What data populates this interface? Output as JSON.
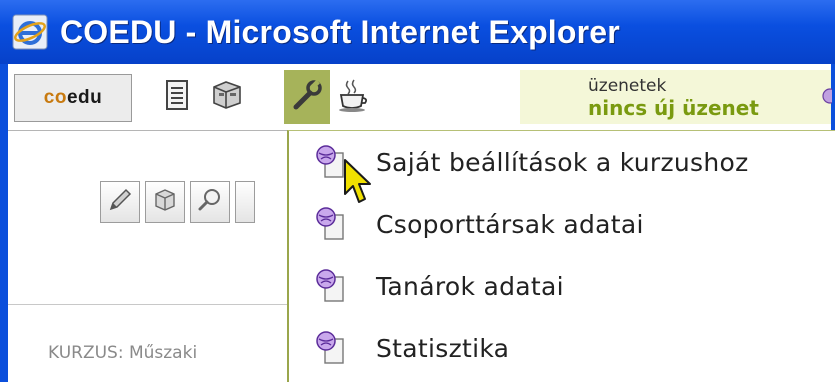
{
  "window": {
    "title": "COEDU - Microsoft Internet Explorer"
  },
  "app": {
    "logo_co": "co",
    "logo_edu": "edu",
    "toolbar_icons": [
      "document-list-icon",
      "folder-box-icon",
      "wrench-icon",
      "coffee-cup-icon"
    ],
    "active_tool": "wrench-icon",
    "messages": {
      "label": "üzenetek",
      "status": "nincs új üzenet"
    }
  },
  "left_panel": {
    "tool_icons": [
      "pencil-icon",
      "box-icon",
      "magnifier-icon"
    ],
    "course_label": "KURZUS: Műszaki"
  },
  "menu": {
    "items": [
      {
        "label": "Saját beállítások a kurzushoz",
        "icon": "document-globe-icon"
      },
      {
        "label": "Csoporttársak adatai",
        "icon": "document-globe-icon"
      },
      {
        "label": "Tanárok adatai",
        "icon": "document-globe-icon"
      },
      {
        "label": "Statisztika",
        "icon": "document-globe-icon"
      }
    ]
  },
  "colors": {
    "titlebar": "#0a4fe0",
    "active_tab": "#a6b35a",
    "message_status": "#7a9a10",
    "cursor": "#f0e000"
  }
}
